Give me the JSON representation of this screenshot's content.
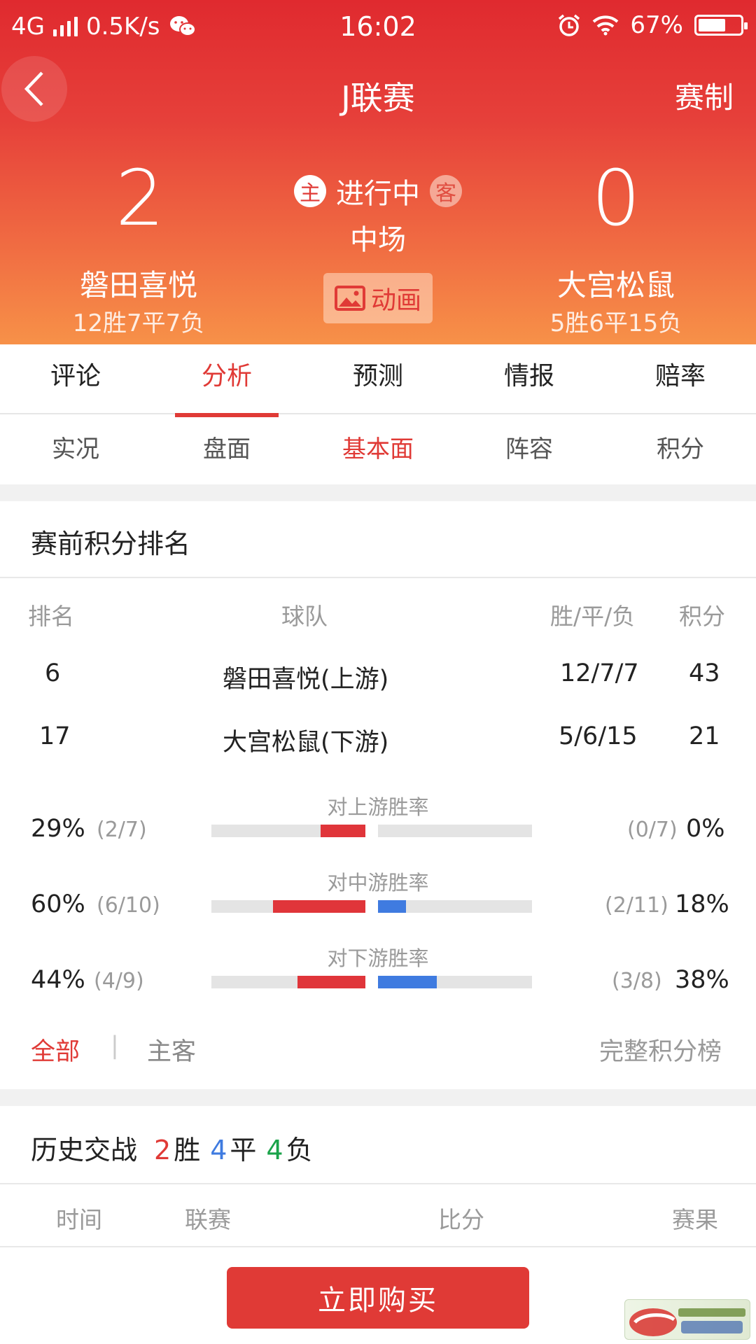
{
  "status_bar": {
    "network": "4G",
    "speed": "0.5K/s",
    "time": "16:02",
    "battery": "67%",
    "battery_level": 0.67
  },
  "header": {
    "title": "J联赛",
    "right_action": "赛制"
  },
  "match": {
    "home": {
      "score": "2",
      "name": "磐田喜悦",
      "record": "12胜7平7负",
      "tag": "主"
    },
    "away": {
      "score": "0",
      "name": "大宫松鼠",
      "record": "5胜6平15负",
      "tag": "客"
    },
    "status": "进行中",
    "period": "中场",
    "animation_label": "动画"
  },
  "tabs": [
    {
      "label": "评论"
    },
    {
      "label": "分析"
    },
    {
      "label": "预测"
    },
    {
      "label": "情报"
    },
    {
      "label": "赔率"
    }
  ],
  "active_tab": "分析",
  "subtabs": [
    {
      "label": "实况"
    },
    {
      "label": "盘面"
    },
    {
      "label": "基本面"
    },
    {
      "label": "阵容"
    },
    {
      "label": "积分"
    }
  ],
  "active_subtab": "基本面",
  "standings": {
    "title": "赛前积分排名",
    "headers": {
      "rank": "排名",
      "team": "球队",
      "wdl": "胜/平/负",
      "points": "积分"
    },
    "rows": [
      {
        "rank": "6",
        "team": "磐田喜悦(上游)",
        "wdl": "12/7/7",
        "points": "43"
      },
      {
        "rank": "17",
        "team": "大宫松鼠(下游)",
        "wdl": "5/6/15",
        "points": "21"
      }
    ],
    "rates": [
      {
        "label": "对上游胜率",
        "home_pct": "29%",
        "home_frac": "(2/7)",
        "home_value": 0.29,
        "away_pct": "0%",
        "away_frac": "(0/7)",
        "away_value": 0.0
      },
      {
        "label": "对中游胜率",
        "home_pct": "60%",
        "home_frac": "(6/10)",
        "home_value": 0.6,
        "away_pct": "18%",
        "away_frac": "(2/11)",
        "away_value": 0.18
      },
      {
        "label": "对下游胜率",
        "home_pct": "44%",
        "home_frac": "(4/9)",
        "home_value": 0.44,
        "away_pct": "38%",
        "away_frac": "(3/8)",
        "away_value": 0.38
      }
    ],
    "filter": {
      "all": "全部",
      "home_away": "主客",
      "full_table": "完整积分榜",
      "separator": "|"
    }
  },
  "history": {
    "title": "历史交战",
    "wins": "2",
    "win_label": "胜",
    "draws": "4",
    "draw_label": "平",
    "losses": "4",
    "loss_label": "负",
    "headers": {
      "time": "时间",
      "league": "联赛",
      "score": "比分",
      "result": "赛果"
    }
  },
  "buy_button": "立即购买",
  "colors": {
    "accent": "#e03a36",
    "home_bar": "#e0353a",
    "away_bar": "#3f7be0",
    "draw": "#3f7be0",
    "loss": "#1aa34a"
  }
}
